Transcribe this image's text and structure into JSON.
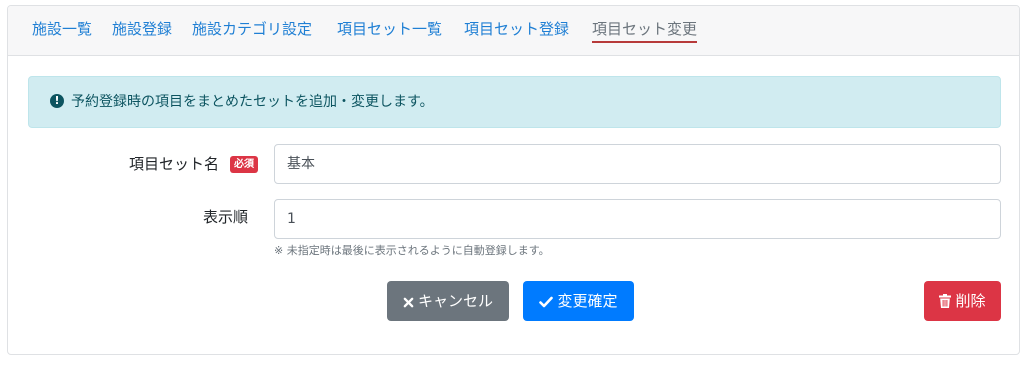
{
  "nav": {
    "tabs": [
      {
        "label": "施設一覧"
      },
      {
        "label": "施設登録"
      },
      {
        "label": "施設カテゴリ設定"
      },
      {
        "label": "項目セット一覧"
      },
      {
        "label": "項目セット登録"
      },
      {
        "label": "項目セット変更"
      }
    ],
    "active_index": 5
  },
  "alert": {
    "icon": "exclamation-circle-icon",
    "text": "予約登録時の項目をまとめたセットを追加・変更します。"
  },
  "form": {
    "name_label": "項目セット名",
    "required_badge": "必須",
    "name_value": "基本",
    "order_label": "表示順",
    "order_value": "1",
    "order_help": "※ 未指定時は最後に表示されるように自動登録します。"
  },
  "buttons": {
    "cancel": "キャンセル",
    "confirm": "変更確定",
    "delete": "削除"
  },
  "colors": {
    "link": "#1f7fd4",
    "active_underline": "#b73a3a",
    "alert_bg": "#d1ecf1",
    "cancel": "#6c757d",
    "confirm": "#007bff",
    "delete": "#dc3545"
  }
}
